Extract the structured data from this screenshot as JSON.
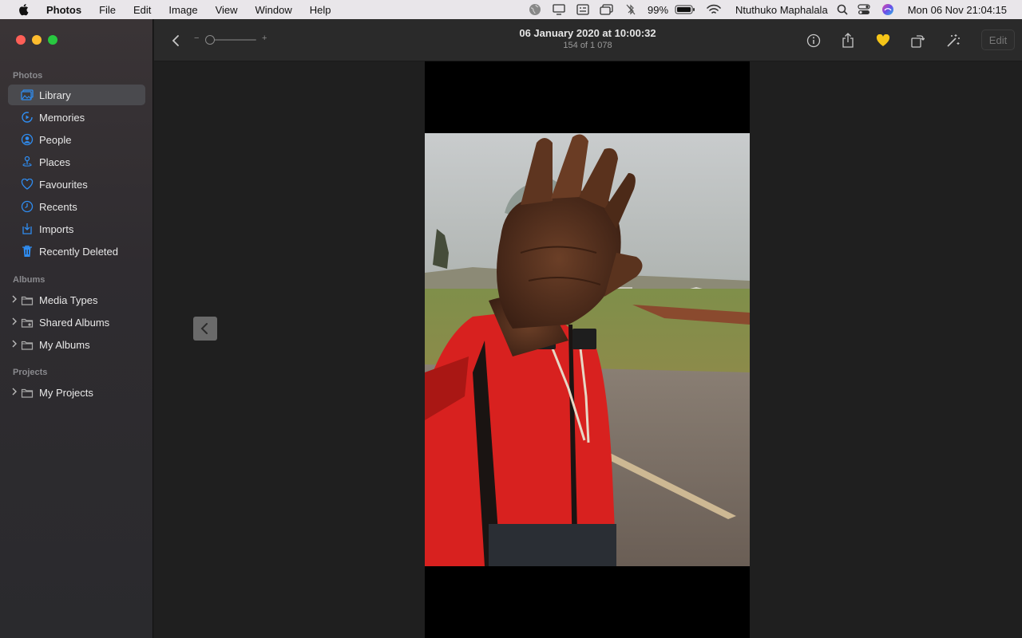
{
  "menubar": {
    "app_name": "Photos",
    "menus": [
      "File",
      "Edit",
      "Image",
      "View",
      "Window",
      "Help"
    ],
    "battery": "99%",
    "user": "Ntuthuko Maphalala",
    "datetime": "Mon 06 Nov  21:04:15"
  },
  "sidebar": {
    "photos_header": "Photos",
    "items": [
      {
        "label": "Library",
        "icon": "library-icon"
      },
      {
        "label": "Memories",
        "icon": "memories-icon"
      },
      {
        "label": "People",
        "icon": "people-icon"
      },
      {
        "label": "Places",
        "icon": "places-icon"
      },
      {
        "label": "Favourites",
        "icon": "heart-icon"
      },
      {
        "label": "Recents",
        "icon": "clock-icon"
      },
      {
        "label": "Imports",
        "icon": "import-icon"
      },
      {
        "label": "Recently Deleted",
        "icon": "trash-icon"
      }
    ],
    "albums_header": "Albums",
    "albums": [
      {
        "label": "Media Types"
      },
      {
        "label": "Shared Albums"
      },
      {
        "label": "My Albums"
      }
    ],
    "projects_header": "Projects",
    "projects": [
      {
        "label": "My Projects"
      }
    ]
  },
  "toolbar": {
    "title": "06 January 2020 at 10:00:32",
    "subtitle": "154 of 1 078",
    "zoom_minus": "−",
    "zoom_plus": "+",
    "edit_label": "Edit"
  },
  "colors": {
    "accent": "#2f8cf0",
    "favourite": "#f5c518"
  }
}
